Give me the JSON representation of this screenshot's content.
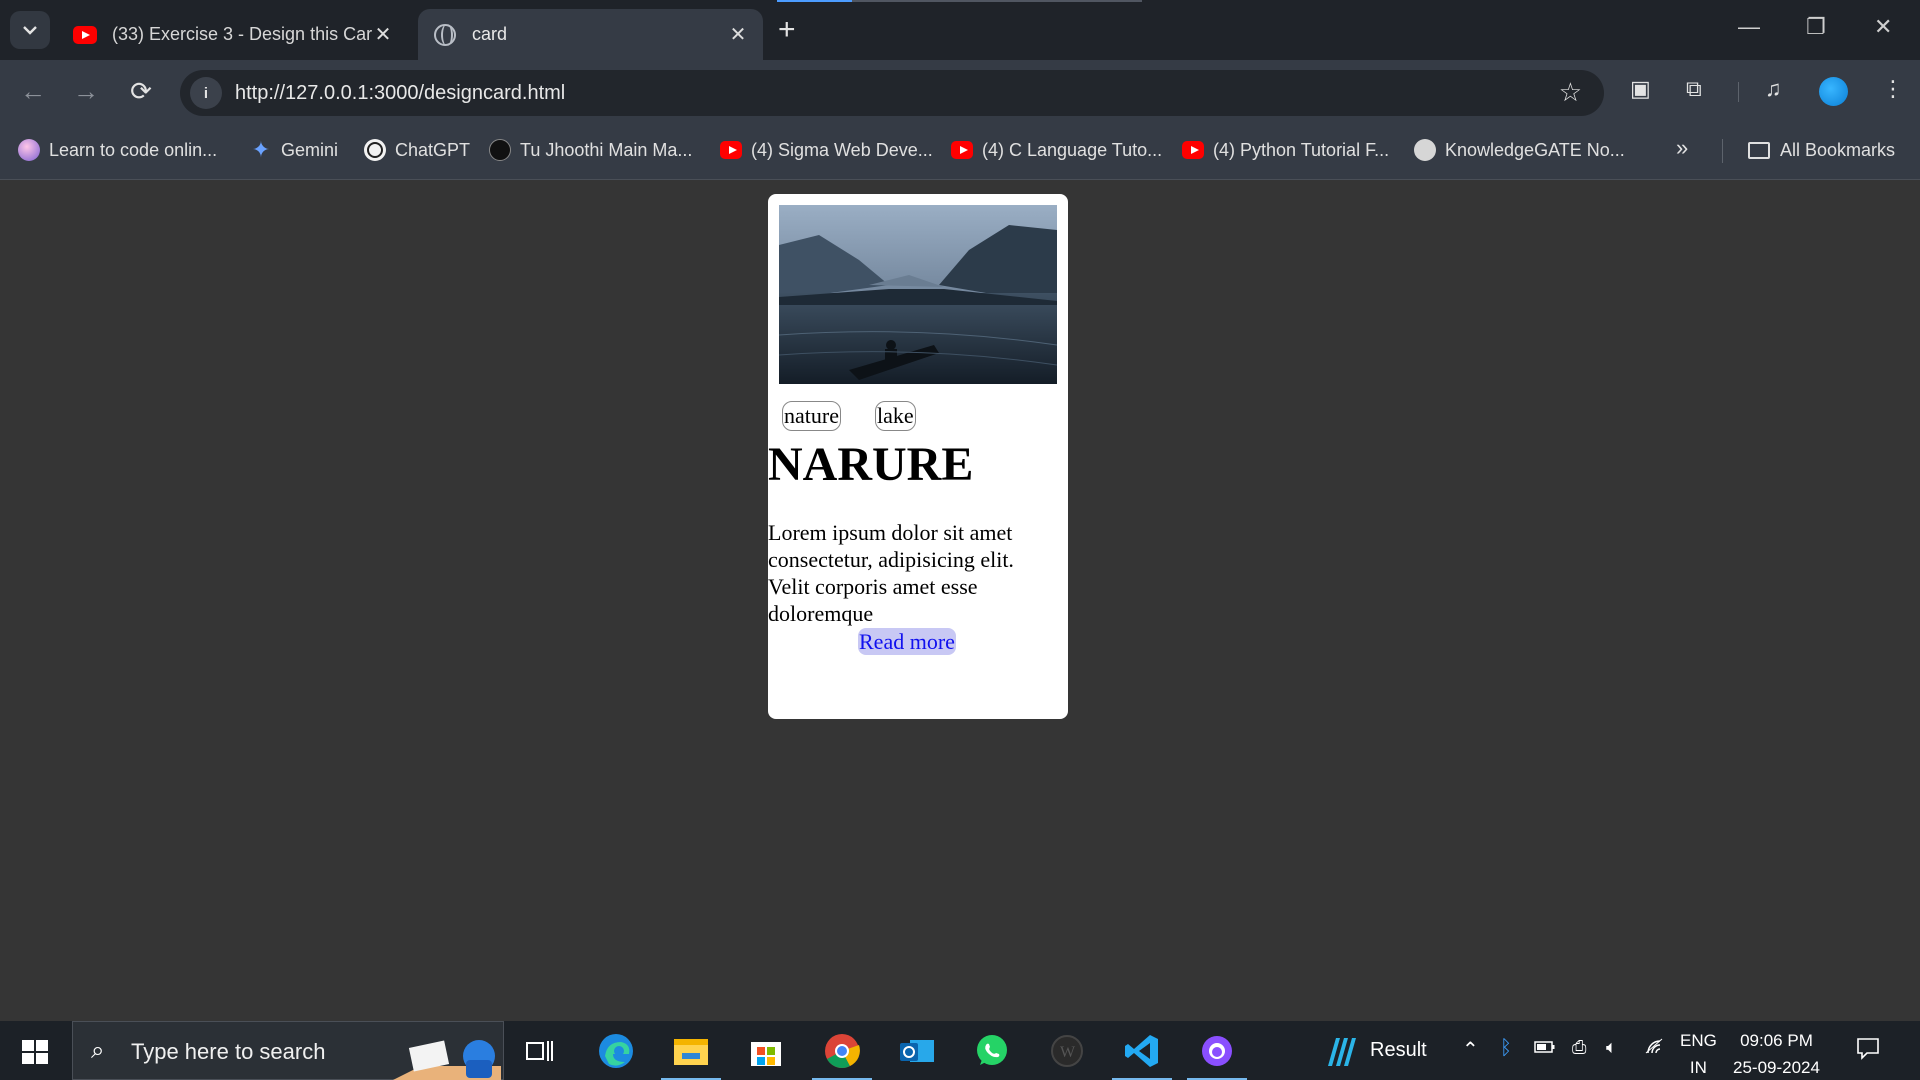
{
  "browser": {
    "tabs": [
      {
        "title": "(33) Exercise 3 - Design this Car",
        "icon": "youtube-icon",
        "active": false
      },
      {
        "title": "card",
        "icon": "globe-icon",
        "active": true
      }
    ],
    "url": "http://127.0.0.1:3000/designcard.html",
    "bookmarks": [
      {
        "label": "Learn to code onlin...",
        "icon": "avatar-icon"
      },
      {
        "label": "Gemini",
        "icon": "gemini-icon"
      },
      {
        "label": "ChatGPT",
        "icon": "chatgpt-icon"
      },
      {
        "label": "Tu Jhoothi Main Ma...",
        "icon": "music-icon"
      },
      {
        "label": "(4) Sigma Web Deve...",
        "icon": "youtube-icon"
      },
      {
        "label": "(4) C Language Tuto...",
        "icon": "youtube-icon"
      },
      {
        "label": "(4) Python Tutorial F...",
        "icon": "youtube-icon"
      },
      {
        "label": "KnowledgeGATE No...",
        "icon": "globe-icon"
      }
    ],
    "all_bookmarks": "All Bookmarks"
  },
  "card": {
    "tags": [
      "nature",
      "lake"
    ],
    "title": "NARURE",
    "text": "Lorem ipsum dolor sit amet consectetur, adipisicing elit. Velit corporis amet esse doloremque",
    "button": "Read more"
  },
  "taskbar": {
    "search_placeholder": "Type here to search",
    "weather_label": "Result",
    "lang_top": "ENG",
    "lang_bottom": "IN",
    "time": "09:06 PM",
    "date": "25-09-2024"
  },
  "colors": {
    "accent": "#4c9cff",
    "page_bg": "#353535",
    "toolbar_bg": "#353b45"
  }
}
